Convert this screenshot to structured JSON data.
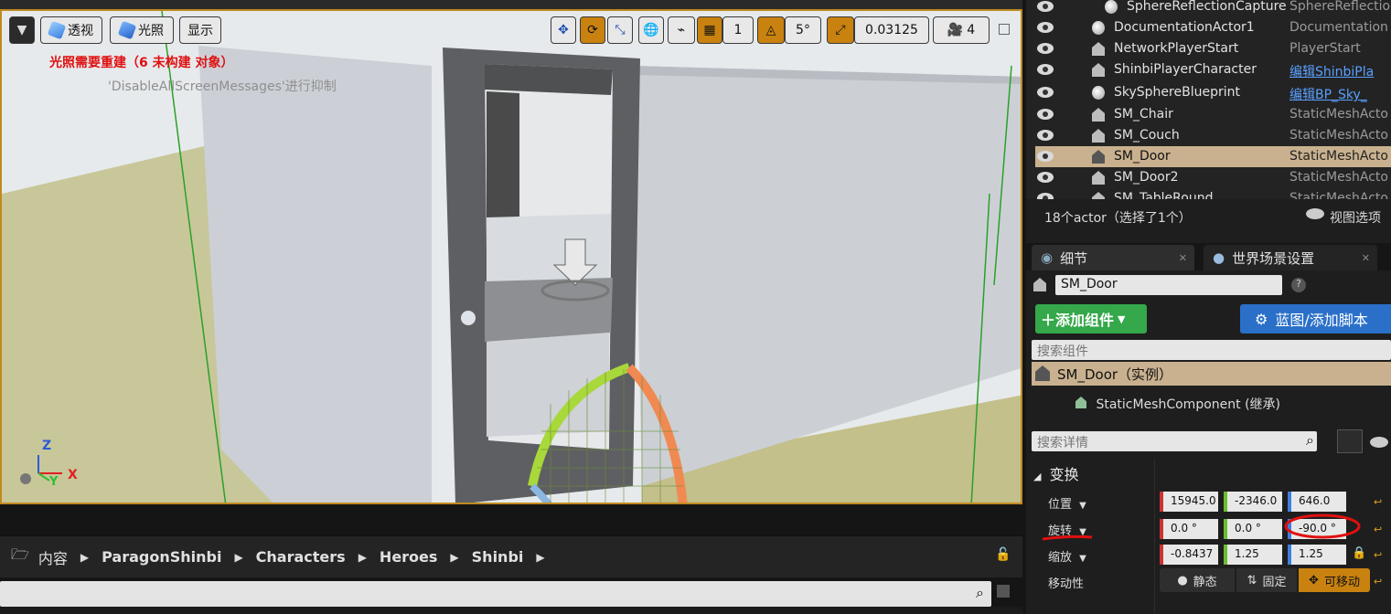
{
  "viewport": {
    "perspective_label": "透视",
    "lighting_label": "光照",
    "show_label": "显示",
    "snap_grid_value": "1",
    "snap_angle_value": "5°",
    "snap_scale_value": "0.03125",
    "camera_speed_value": "4",
    "warning_text": "光照需要重建（6 未构建 对象）",
    "message_text": "'DisableAllScreenMessages'进行抑制",
    "axis": {
      "z": "Z",
      "y": "Y",
      "x": "X"
    }
  },
  "content_browser": {
    "root_label": "内容",
    "breadcrumbs": [
      "ParagonShinbi",
      "Characters",
      "Heroes",
      "Shinbi"
    ]
  },
  "outliner": {
    "rows": [
      {
        "name": "SphereReflectionCapture",
        "type": "SphereReflectio",
        "selected": false
      },
      {
        "name": "DocumentationActor1",
        "type": "Documentation",
        "selected": false
      },
      {
        "name": "NetworkPlayerStart",
        "type": "PlayerStart",
        "selected": false
      },
      {
        "name": "ShinbiPlayerCharacter",
        "type": "编辑ShinbiPla",
        "selected": false
      },
      {
        "name": "SkySphereBlueprint",
        "type": "编辑BP_Sky_",
        "selected": false
      },
      {
        "name": "SM_Chair",
        "type": "StaticMeshActo",
        "selected": false
      },
      {
        "name": "SM_Couch",
        "type": "StaticMeshActo",
        "selected": false
      },
      {
        "name": "SM_Door",
        "type": "StaticMeshActo",
        "selected": true
      },
      {
        "name": "SM_Door2",
        "type": "StaticMeshActo",
        "selected": false
      },
      {
        "name": "SM_TableRound",
        "type": "StaticMeshActo",
        "selected": false
      }
    ],
    "actor_count": "18个actor（选择了1个）",
    "view_options": "视图选项"
  },
  "details": {
    "tab_details": "细节",
    "tab_world": "世界场景设置",
    "actor_name": "SM_Door",
    "add_component": "添加组件",
    "blueprint_button": "蓝图/添加脚本",
    "search_components_placeholder": "搜索组件",
    "component_root": "SM_Door（实例）",
    "component_child": "StaticMeshComponent (继承)",
    "search_details_placeholder": "搜索详情",
    "transform_section": "变换",
    "location_label": "位置",
    "rotation_label": "旋转",
    "scale_label": "缩放",
    "mobility_label": "移动性",
    "location": [
      "15945.0",
      "-2346.0",
      "646.0"
    ],
    "rotation": [
      "0.0 °",
      "0.0 °",
      "-90.0 °"
    ],
    "scale": [
      "-0.8437",
      "1.25",
      "1.25"
    ],
    "mobility_static": "静态",
    "mobility_stationary": "固定",
    "mobility_movable": "可移动"
  }
}
